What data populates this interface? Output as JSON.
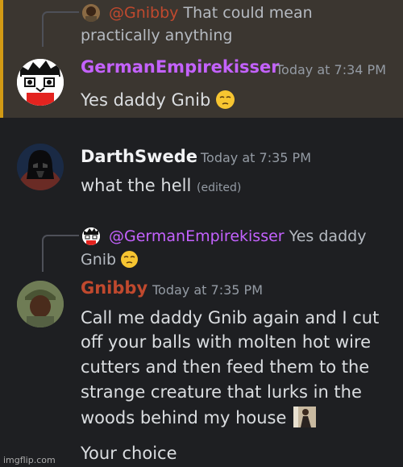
{
  "messages": {
    "m1": {
      "reply_mention": "@Gnibby",
      "reply_text_line1": "That could mean",
      "reply_text_line2": "practically anything",
      "author": "GermanEmpirekisser",
      "time": "Today at 7:34 PM",
      "content": "Yes daddy Gnib",
      "author_color": "#c462ff"
    },
    "m2": {
      "author": "DarthSwede",
      "time": "Today at 7:35 PM",
      "content": "what the hell",
      "edited": "(edited)",
      "author_color": "#f2f3f5"
    },
    "m3": {
      "reply_mention": "@GermanEmpirekisser",
      "reply_text_line1": "Yes daddy",
      "reply_text_line2": "Gnib",
      "author": "Gnibby",
      "time": "Today at 7:35 PM",
      "lines": [
        "Call me daddy Gnib again and I cut",
        "off your balls with molten hot wire",
        "cutters and then feed them to the",
        "strange creature that lurks in the",
        "woods behind my house"
      ],
      "last_line": "Your choice",
      "author_color": "#c0492e"
    }
  },
  "watermark": "imgflip.com",
  "icons": [
    "pensive-emoji",
    "reply-avatar",
    "user-avatar",
    "image-thumbnail"
  ]
}
